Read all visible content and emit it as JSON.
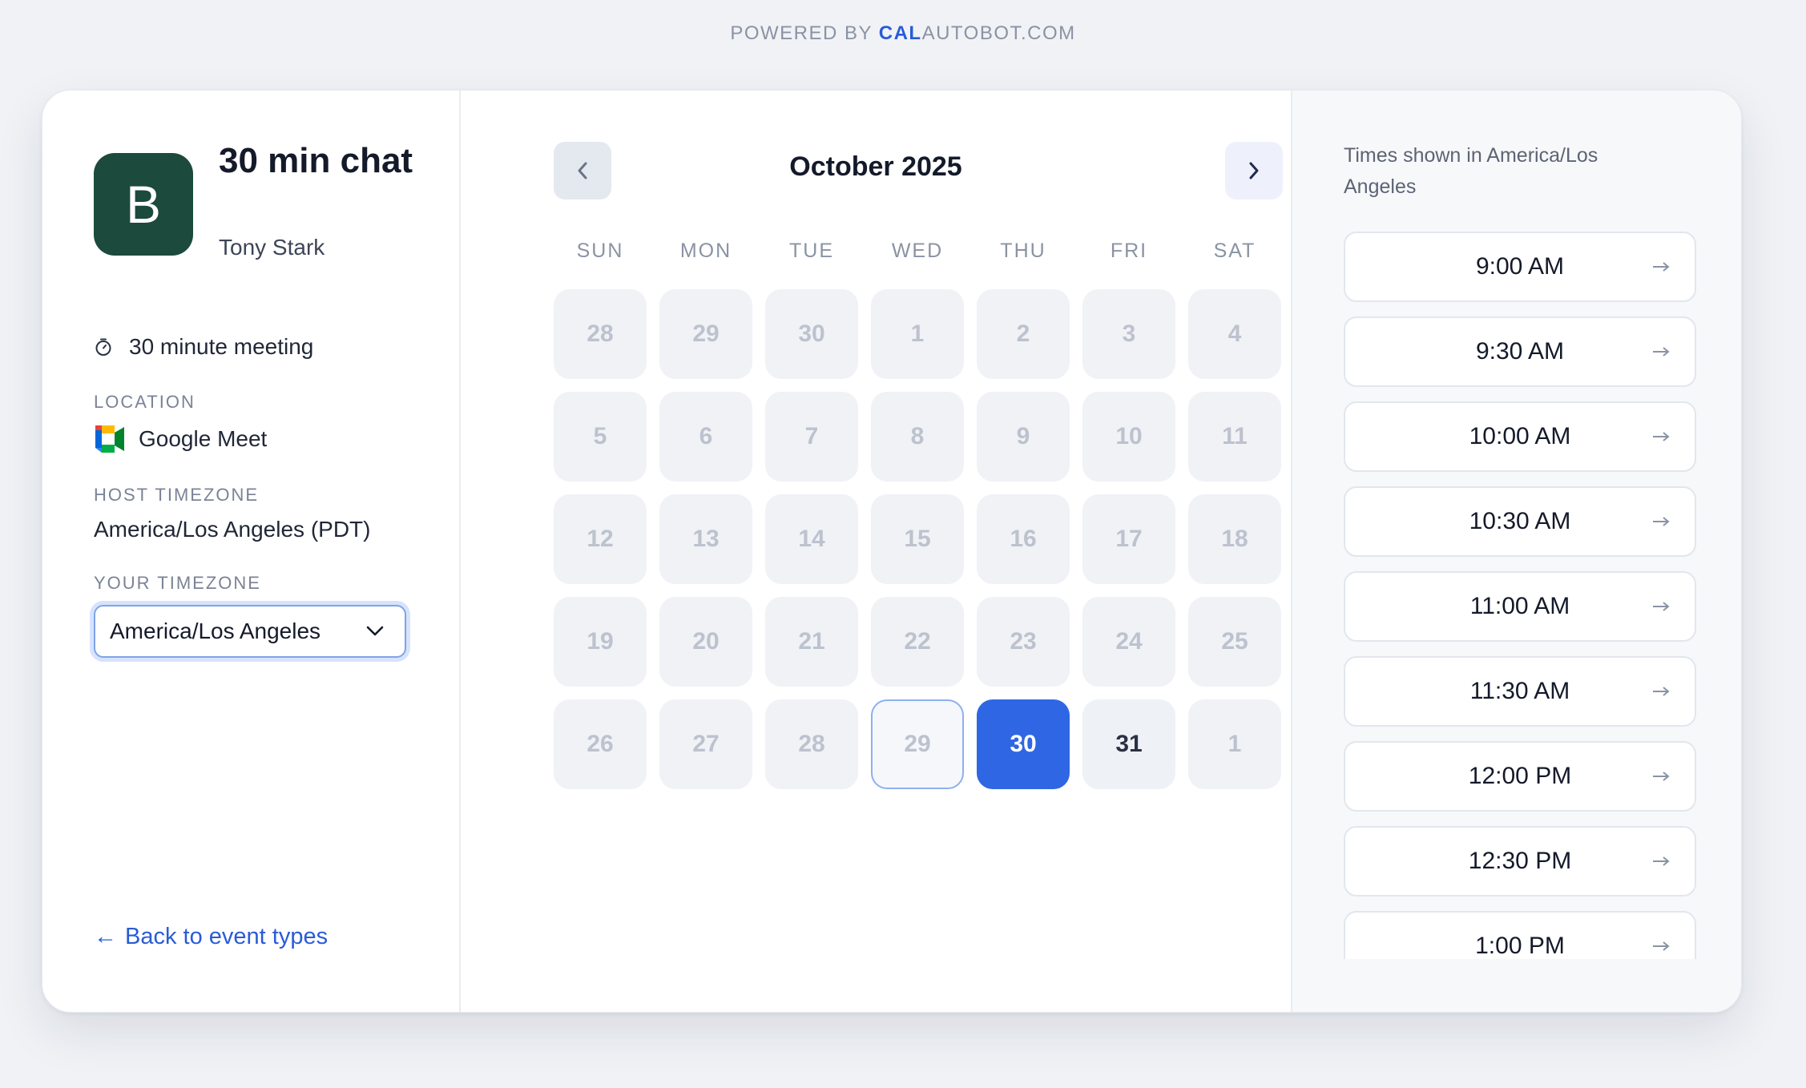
{
  "header": {
    "powered_prefix": "POWERED BY ",
    "brand_bold": "CAL",
    "brand_rest": "AUTOBOT.COM"
  },
  "event": {
    "avatar_letter": "B",
    "title": "30 min chat",
    "host": "Tony Stark",
    "duration": "30 minute meeting",
    "location_label": "LOCATION",
    "location": "Google Meet",
    "host_timezone_label": "HOST TIMEZONE",
    "host_timezone": "America/Los Angeles (PDT)",
    "your_timezone_label": "YOUR TIMEZONE",
    "your_timezone": "America/Los Angeles",
    "back_link": "Back to event types",
    "avatar_color": "#1c4a3c"
  },
  "calendar": {
    "month": "October 2025",
    "weekdays": [
      "SUN",
      "MON",
      "TUE",
      "WED",
      "THU",
      "FRI",
      "SAT"
    ],
    "days": [
      {
        "n": "28",
        "state": "disabled"
      },
      {
        "n": "29",
        "state": "disabled"
      },
      {
        "n": "30",
        "state": "disabled"
      },
      {
        "n": "1",
        "state": "disabled"
      },
      {
        "n": "2",
        "state": "disabled"
      },
      {
        "n": "3",
        "state": "disabled"
      },
      {
        "n": "4",
        "state": "disabled"
      },
      {
        "n": "5",
        "state": "disabled"
      },
      {
        "n": "6",
        "state": "disabled"
      },
      {
        "n": "7",
        "state": "disabled"
      },
      {
        "n": "8",
        "state": "disabled"
      },
      {
        "n": "9",
        "state": "disabled"
      },
      {
        "n": "10",
        "state": "disabled"
      },
      {
        "n": "11",
        "state": "disabled"
      },
      {
        "n": "12",
        "state": "disabled"
      },
      {
        "n": "13",
        "state": "disabled"
      },
      {
        "n": "14",
        "state": "disabled"
      },
      {
        "n": "15",
        "state": "disabled"
      },
      {
        "n": "16",
        "state": "disabled"
      },
      {
        "n": "17",
        "state": "disabled"
      },
      {
        "n": "18",
        "state": "disabled"
      },
      {
        "n": "19",
        "state": "disabled"
      },
      {
        "n": "20",
        "state": "disabled"
      },
      {
        "n": "21",
        "state": "disabled"
      },
      {
        "n": "22",
        "state": "disabled"
      },
      {
        "n": "23",
        "state": "disabled"
      },
      {
        "n": "24",
        "state": "disabled"
      },
      {
        "n": "25",
        "state": "disabled"
      },
      {
        "n": "26",
        "state": "disabled"
      },
      {
        "n": "27",
        "state": "disabled"
      },
      {
        "n": "28",
        "state": "disabled"
      },
      {
        "n": "29",
        "state": "today"
      },
      {
        "n": "30",
        "state": "selected"
      },
      {
        "n": "31",
        "state": "available"
      },
      {
        "n": "1",
        "state": "disabled"
      }
    ],
    "selected_color": "#2f66e3"
  },
  "times": {
    "note": "Times shown in America/Los Angeles",
    "slots": [
      "9:00 AM",
      "9:30 AM",
      "10:00 AM",
      "10:30 AM",
      "11:00 AM",
      "11:30 AM",
      "12:00 PM",
      "12:30 PM",
      "1:00 PM"
    ]
  }
}
